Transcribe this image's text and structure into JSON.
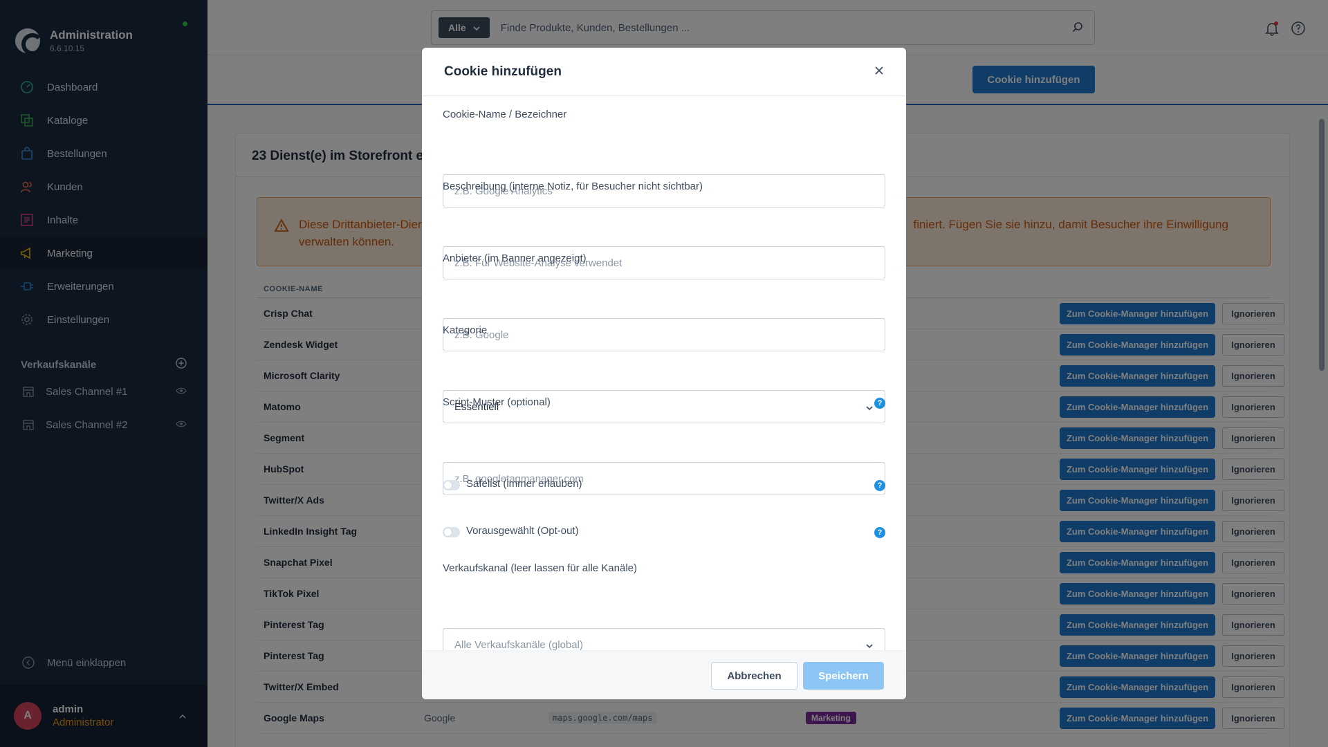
{
  "app": {
    "title": "Administration",
    "version": "6.6.10.15"
  },
  "nav": [
    {
      "label": "Dashboard",
      "icon": "gauge-icon"
    },
    {
      "label": "Kataloge",
      "icon": "catalog-icon"
    },
    {
      "label": "Bestellungen",
      "icon": "bag-icon"
    },
    {
      "label": "Kunden",
      "icon": "users-icon"
    },
    {
      "label": "Inhalte",
      "icon": "content-icon"
    },
    {
      "label": "Marketing",
      "icon": "megaphone-icon",
      "active": true
    },
    {
      "label": "Erweiterungen",
      "icon": "plug-icon"
    },
    {
      "label": "Einstellungen",
      "icon": "gear-icon"
    }
  ],
  "sales_channels": {
    "title": "Verkaufskanäle",
    "items": [
      {
        "label": "Sales Channel #1"
      },
      {
        "label": "Sales Channel #2"
      }
    ]
  },
  "collapse_label": "Menü einklappen",
  "user": {
    "initial": "A",
    "name": "admin",
    "role": "Administrator"
  },
  "search": {
    "scope": "Alle",
    "placeholder": "Finde Produkte, Kunden, Bestellungen ..."
  },
  "toolbar": {
    "add_cookie_label": "Cookie hinzufügen"
  },
  "card": {
    "title": "23 Dienst(e) im Storefront er",
    "alert_text_left": "Diese Drittanbieter-Dier",
    "alert_text_right": "finiert. Fügen Sie sie hinzu, damit Besucher ihre Einwilligung",
    "alert_text_line2": "verwalten können.",
    "column_name": "COOKIE-NAME",
    "add_button_label": "Zum Cookie-Manager hinzufügen",
    "ignore_button_label": "Ignorieren",
    "rows": [
      {
        "name": "Crisp Chat"
      },
      {
        "name": "Zendesk Widget"
      },
      {
        "name": "Microsoft Clarity"
      },
      {
        "name": "Matomo"
      },
      {
        "name": "Segment"
      },
      {
        "name": "HubSpot"
      },
      {
        "name": "Twitter/X Ads"
      },
      {
        "name": "LinkedIn Insight Tag"
      },
      {
        "name": "Snapchat Pixel"
      },
      {
        "name": "TikTok Pixel"
      },
      {
        "name": "Pinterest Tag"
      },
      {
        "name": "Pinterest Tag"
      },
      {
        "name": "Twitter/X Embed"
      },
      {
        "name": "Google Maps",
        "provider": "Google",
        "pattern": "maps.google.com/maps",
        "category": "Marketing"
      }
    ]
  },
  "modal": {
    "title": "Cookie hinzufügen",
    "name_label": "Cookie-Name / Bezeichner",
    "name_placeholder": "z.B. Google Analytics",
    "description_label": "Beschreibung (interne Notiz, für Besucher nicht sichtbar)",
    "description_placeholder": "z.B. Für Website-Analyse verwendet",
    "provider_label": "Anbieter (im Banner angezeigt)",
    "provider_placeholder": "z.B. Google",
    "category_label": "Kategorie",
    "category_value": "Essentiell",
    "script_label": "Script-Muster (optional)",
    "script_placeholder": "z.B. googletagmanager.com",
    "safelist_label": "Safelist (immer erlauben)",
    "preselected_label": "Vorausgewählt (Opt-out)",
    "channel_label": "Verkaufskanal (leer lassen für alle Kanäle)",
    "channel_placeholder": "Alle Verkaufskanäle (global)",
    "cancel_label": "Abbrechen",
    "save_label": "Speichern"
  },
  "colors": {
    "sidebar": "#1b2a40",
    "primary": "#1f7ad1",
    "alert_text": "#cc5a10",
    "marketing_badge": "#7a2a9e",
    "role": "#f39c12"
  }
}
